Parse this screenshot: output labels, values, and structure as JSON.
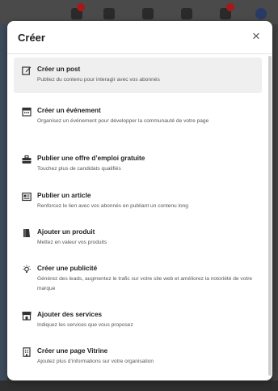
{
  "modal": {
    "title": "Créer",
    "close_label": "×"
  },
  "items": [
    {
      "title": "Créer un post",
      "description": "Publiez du contenu pour interagir avec vos abonnés",
      "icon": "edit-icon"
    },
    {
      "title": "Créer un événement",
      "description": "Organisez un événement pour développer la communauté de votre page",
      "icon": "calendar-icon"
    },
    {
      "title": "Publier une offre d’emploi gratuite",
      "description": "Touchez plus de candidats qualifiés",
      "icon": "briefcase-icon"
    },
    {
      "title": "Publier un article",
      "description": "Renforcez le lien avec vos abonnés en publiant un contenu long",
      "icon": "article-icon"
    },
    {
      "title": "Ajouter un produit",
      "description": "Mettez en valeur vos produits",
      "icon": "product-icon"
    },
    {
      "title": "Créer une publicité",
      "description": "Générez des leads, augmentez le trafic sur votre site web et améliorez la notoriété de votre marque",
      "icon": "lightbulb-icon"
    },
    {
      "title": "Ajouter des services",
      "description": "Indiquez les services que vous proposez",
      "icon": "store-icon"
    },
    {
      "title": "Créer une page Vitrine",
      "description": "Ajoutez plus d’informations sur votre organisation",
      "icon": "building-icon"
    }
  ]
}
